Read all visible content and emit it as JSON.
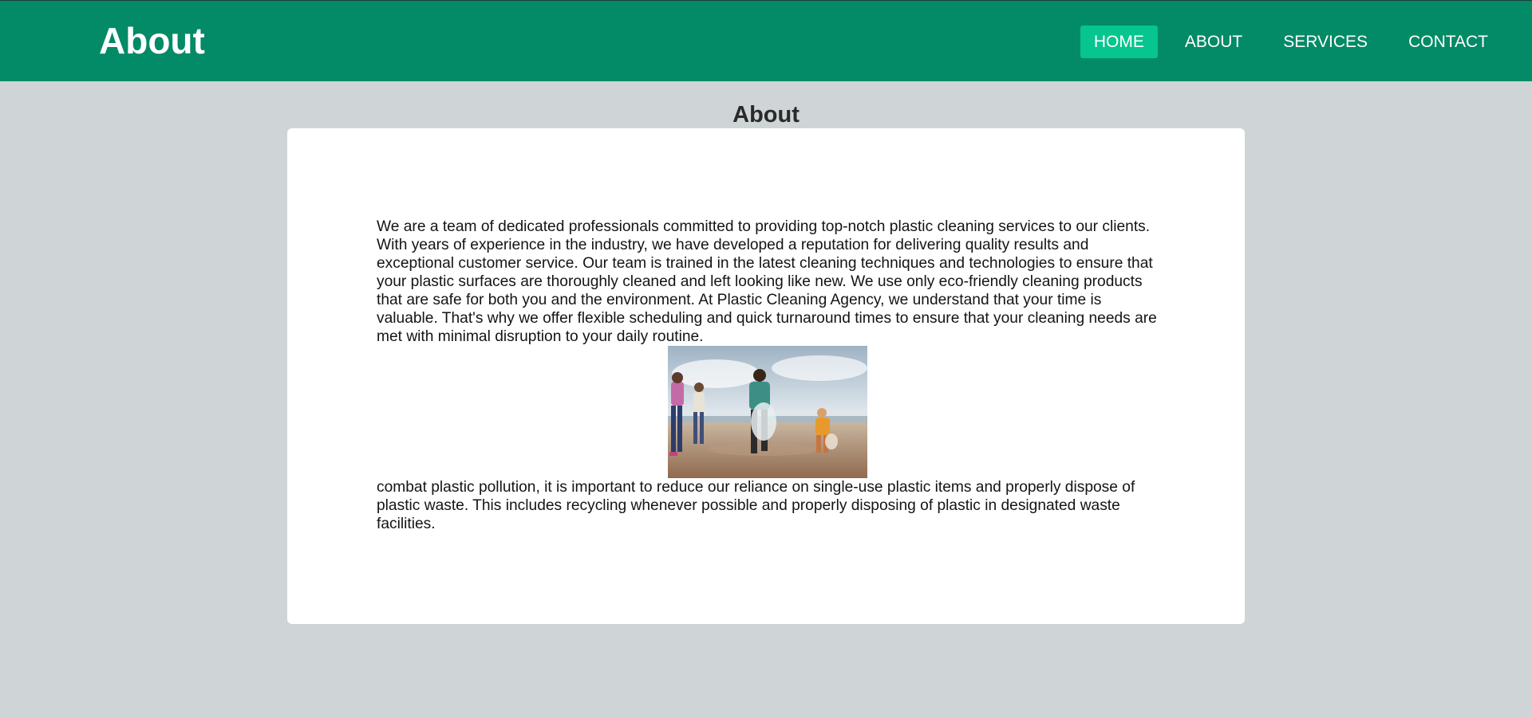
{
  "header": {
    "title": "About",
    "nav": [
      {
        "label": "HOME",
        "active": true
      },
      {
        "label": "ABOUT",
        "active": false
      },
      {
        "label": "SERVICES",
        "active": false
      },
      {
        "label": "CONTACT",
        "active": false
      }
    ]
  },
  "main": {
    "heading": "About",
    "paragraph1": "We are a team of dedicated professionals committed to providing top-notch plastic cleaning services to our clients. With years of experience in the industry, we have developed a reputation for delivering quality results and exceptional customer service. Our team is trained in the latest cleaning techniques and technologies to ensure that your plastic surfaces are thoroughly cleaned and left looking like new. We use only eco-friendly cleaning products that are safe for both you and the environment. At Plastic Cleaning Agency, we understand that your time is valuable. That's why we offer flexible scheduling and quick turnaround times to ensure that your cleaning needs are met with minimal disruption to your daily routine.",
    "paragraph2": "combat plastic pollution, it is important to reduce our reliance on single-use plastic items and properly dispose of plastic waste. This includes recycling whenever possible and properly disposing of plastic in designated waste facilities."
  },
  "colors": {
    "header_bg": "#038a67",
    "nav_active_bg": "#06c58e",
    "page_bg": "#cfd4d7",
    "card_bg": "#ffffff"
  }
}
